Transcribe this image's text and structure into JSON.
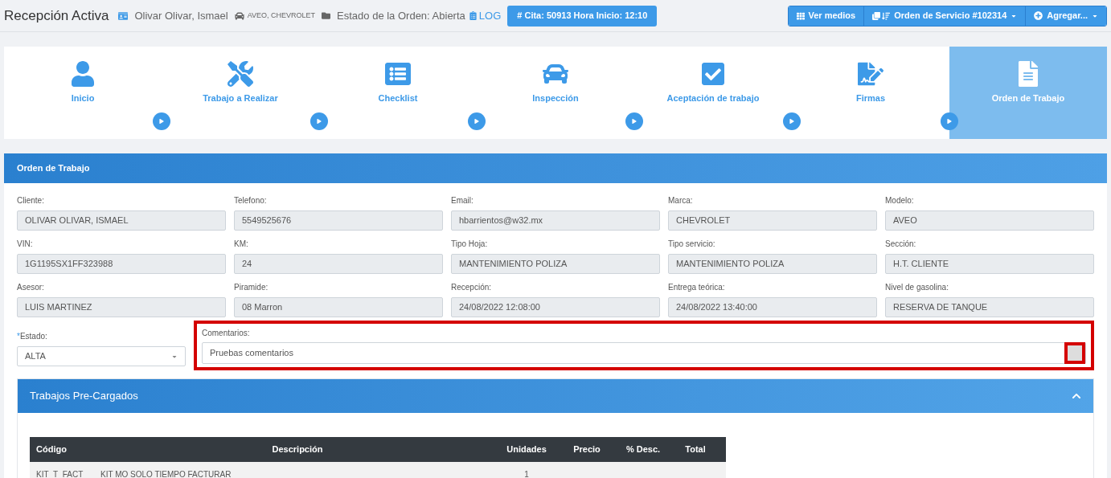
{
  "header": {
    "title": "Recepción Activa",
    "client": "Olivar Olivar, Ismael",
    "vehicle": "AVEO, CHEVROLET",
    "order_status": "Estado de la Orden: Abierta",
    "log_link": "LOG",
    "appointment_button": "# Cita: 50913 Hora Inicio: 12:10"
  },
  "toolbar": [
    {
      "label": "Ver medios",
      "kind": "media"
    },
    {
      "label": "Orden de Servicio #102314",
      "kind": "order"
    },
    {
      "label": "Agregar...",
      "kind": "add"
    }
  ],
  "steps": [
    {
      "label": "Inicio",
      "kind": "user",
      "selected": false
    },
    {
      "label": "Trabajo a Realizar",
      "kind": "tools",
      "selected": false
    },
    {
      "label": "Checklist",
      "kind": "list",
      "selected": false
    },
    {
      "label": "Inspección",
      "kind": "car",
      "selected": false
    },
    {
      "label": "Aceptación de trabajo",
      "kind": "check",
      "selected": false
    },
    {
      "label": "Firmas",
      "kind": "sign",
      "selected": false
    },
    {
      "label": "Orden de Trabajo",
      "kind": "file",
      "selected": true
    }
  ],
  "panel": {
    "title": "Orden de Trabajo",
    "fields": [
      {
        "label": "Cliente:",
        "value": "OLIVAR OLIVAR, ISMAEL"
      },
      {
        "label": "Telefono:",
        "value": "5549525676"
      },
      {
        "label": "Email:",
        "value": "hbarrientos@w32.mx"
      },
      {
        "label": "Marca:",
        "value": "CHEVROLET"
      },
      {
        "label": "Modelo:",
        "value": "AVEO"
      },
      {
        "label": "VIN:",
        "value": "1G1195SX1FF323988"
      },
      {
        "label": "KM:",
        "value": "24"
      },
      {
        "label": "Tipo Hoja:",
        "value": "MANTENIMIENTO POLIZA"
      },
      {
        "label": "Tipo servicio:",
        "value": "MANTENIMIENTO POLIZA"
      },
      {
        "label": "Sección:",
        "value": "H.T. CLIENTE"
      },
      {
        "label": "Asesor:",
        "value": "LUIS MARTINEZ"
      },
      {
        "label": "Piramide:",
        "value": "08 Marron"
      },
      {
        "label": "Recepción:",
        "value": "24/08/2022 12:08:00"
      },
      {
        "label": "Entrega teórica:",
        "value": "24/08/2022 13:40:00"
      },
      {
        "label": "Nivel de gasolina:",
        "value": "RESERVA DE TANQUE"
      }
    ],
    "estado": {
      "required_mark": "*",
      "label": "Estado:",
      "value": "ALTA"
    },
    "comments": {
      "label": "Comentarios:",
      "value": "Pruebas comentarios"
    },
    "precargados": {
      "title": "Trabajos Pre-Cargados",
      "expanded": true,
      "columns": [
        "Código",
        "Descripción",
        "Unidades",
        "Precio",
        "% Desc.",
        "Total"
      ],
      "rows": [
        [
          "KIT_T_FACT",
          "KIT MO SOLO TIEMPO FACTURAR",
          "1",
          "",
          "",
          ""
        ]
      ]
    }
  }
}
